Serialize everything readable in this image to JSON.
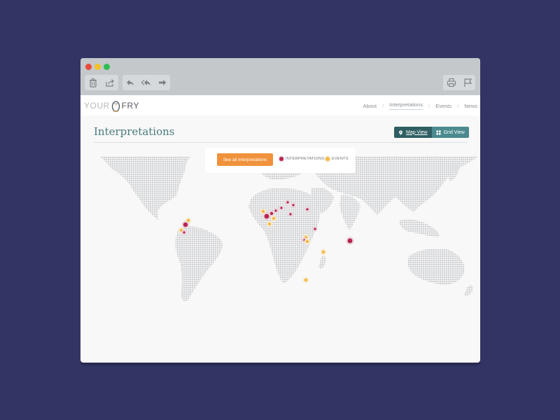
{
  "window": {
    "traffic_lights": [
      "close",
      "minimize",
      "maximize"
    ]
  },
  "toolbar": {
    "left_group": [
      "trash-icon",
      "share-icon"
    ],
    "nav_group": [
      "reply-icon",
      "reply-all-icon",
      "forward-icon"
    ],
    "right_group": [
      "print-icon",
      "flag-icon"
    ]
  },
  "site": {
    "logo_left": "YOUR",
    "logo_right": "FRY",
    "nav": [
      "About",
      "Interpretations",
      "Events",
      "News"
    ],
    "nav_separator": "/",
    "active_nav": "Interpretations"
  },
  "page": {
    "title": "Interpretations",
    "map_view_label": "Map View",
    "grid_view_label": "Grid View"
  },
  "legend": {
    "see_all_label": "See all interpretations",
    "interpretations_label": "INTERPRETATIONS",
    "events_label": "EVENTS"
  },
  "colors": {
    "background": "#323463",
    "accent_orange": "#f0923b",
    "interpretation_marker": "#b8244f",
    "event_marker": "#f4b940",
    "teal": "#4a7b7e"
  },
  "markers": [
    {
      "type": "event",
      "lon": -71
    },
    {
      "type": "interpretation",
      "lon": -80
    },
    {
      "type": "event",
      "lon": -84
    },
    {
      "type": "interpretation",
      "lon": -80
    },
    {
      "type": "event",
      "lon": -5
    },
    {
      "type": "interpretation",
      "lon": -2
    },
    {
      "type": "interpretation",
      "lon": 2
    },
    {
      "type": "event",
      "lon": 5
    },
    {
      "type": "interpretation",
      "lon": 12
    },
    {
      "type": "interpretation",
      "lon": 13
    },
    {
      "type": "interpretation",
      "lon": 14
    },
    {
      "type": "interpretation",
      "lon": 20
    },
    {
      "type": "event",
      "lon": 7
    },
    {
      "type": "interpretation",
      "lon": 27
    },
    {
      "type": "interpretation",
      "lon": 35
    },
    {
      "type": "interpretation",
      "lon": 37
    },
    {
      "type": "event",
      "lon": 34
    },
    {
      "type": "interpretation",
      "lon": 35
    },
    {
      "type": "event",
      "lon": 35
    },
    {
      "type": "event",
      "lon": 39
    },
    {
      "type": "interpretation",
      "lon": 77
    },
    {
      "type": "event",
      "lon": 36
    }
  ]
}
